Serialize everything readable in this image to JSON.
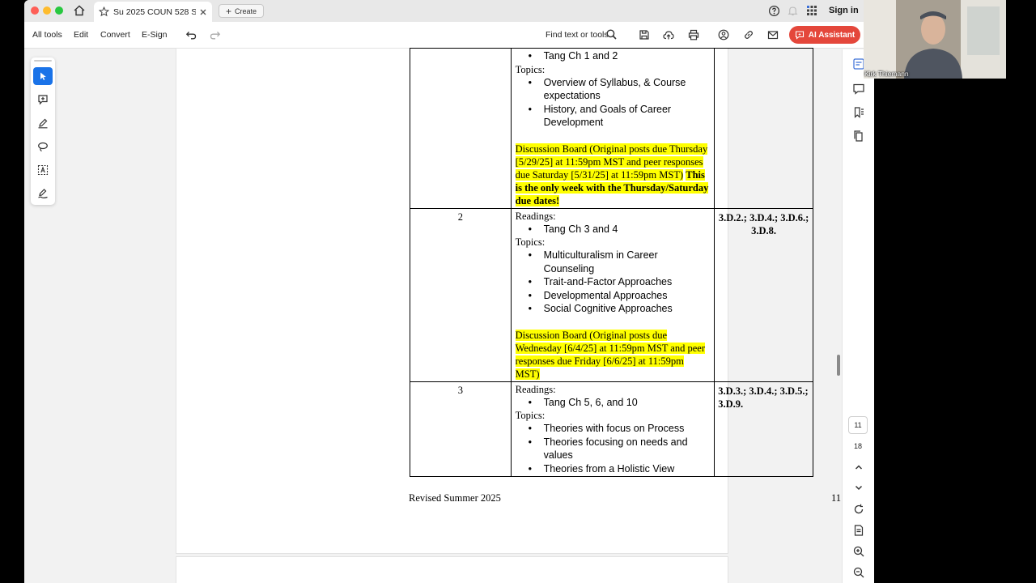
{
  "browser": {
    "tab_title": "Su 2025 COUN 528 Syll...",
    "create_label": "Create",
    "signin_label": "Sign in"
  },
  "toolbar": {
    "all_tools": "All tools",
    "edit": "Edit",
    "convert": "Convert",
    "esign": "E-Sign",
    "find_label": "Find text or tools",
    "ai_label": "AI Assistant"
  },
  "syllabus": {
    "rows": [
      {
        "week": "",
        "readings_label": "",
        "readings": [
          "Tang Ch 1 and 2"
        ],
        "topics_label": "Topics:",
        "topics": [
          "Overview of Syllabus, & Course expectations",
          "History, and Goals of Career Development"
        ],
        "discussion": "Discussion Board (Original posts due Thursday [5/29/25] at 11:59pm MST and peer responses due Saturday [5/31/25] at 11:59pm MST)",
        "discussion_bold": "This is the only week with the Thursday/Saturday due dates!",
        "standards": ""
      },
      {
        "week": "2",
        "readings_label": "Readings:",
        "readings": [
          "Tang Ch 3 and 4"
        ],
        "topics_label": "Topics:",
        "topics": [
          "Multiculturalism in Career Counseling",
          "Trait-and-Factor Approaches",
          "Developmental Approaches",
          "Social Cognitive Approaches"
        ],
        "discussion": "Discussion Board (Original posts due Wednesday [6/4/25] at 11:59pm MST and peer responses due Friday [6/6/25] at 11:59pm MST)",
        "discussion_bold": "",
        "standards": "3.D.2.; 3.D.4.; 3.D.6.; 3.D.8."
      },
      {
        "week": "3",
        "readings_label": "Readings:",
        "readings": [
          "Tang Ch 5, 6, and 10"
        ],
        "topics_label": "Topics:",
        "topics": [
          "Theories with focus on Process",
          "Theories focusing on needs and values",
          "Theories from a Holistic View"
        ],
        "discussion": "",
        "discussion_bold": "",
        "standards": "3.D.3.; 3.D.4.; 3.D.5.; 3.D.9."
      }
    ],
    "footer_left": "Revised Summer 2025",
    "footer_right": "11"
  },
  "pagination": {
    "current_page": "11",
    "total_pages": "18"
  },
  "webcam": {
    "participant_name": "Kirk Thiemann"
  },
  "colors": {
    "highlight": "#ffff00",
    "ai_button": "#e4473b",
    "active_tool": "#1a73e8"
  }
}
